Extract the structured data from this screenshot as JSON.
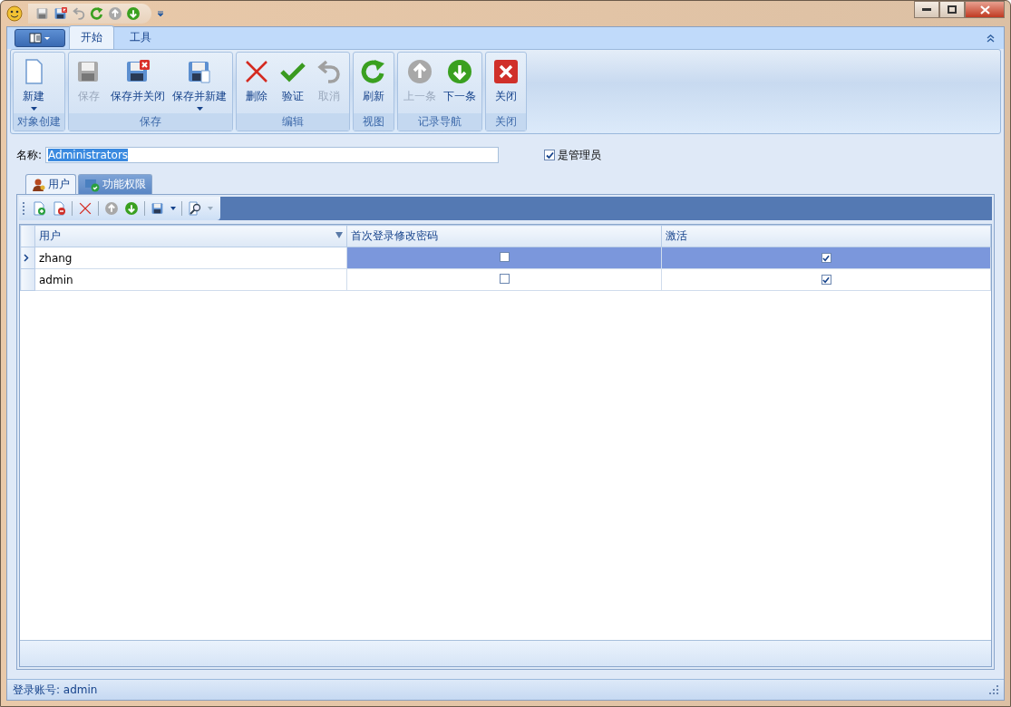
{
  "ribbon": {
    "tabs": [
      {
        "label": "开始",
        "selected": true
      },
      {
        "label": "工具",
        "selected": false
      }
    ],
    "groups": [
      {
        "label": "对象创建",
        "buttons": [
          {
            "kind": "new",
            "label": "新建",
            "disabled": false,
            "dropdown": true
          }
        ]
      },
      {
        "label": "保存",
        "buttons": [
          {
            "kind": "save",
            "label": "保存",
            "disabled": true,
            "dropdown": false
          },
          {
            "kind": "save-close",
            "label": "保存并关闭",
            "disabled": false,
            "dropdown": false
          },
          {
            "kind": "save-new",
            "label": "保存并新建",
            "disabled": false,
            "dropdown": true
          }
        ]
      },
      {
        "label": "编辑",
        "buttons": [
          {
            "kind": "delete",
            "label": "删除",
            "disabled": false,
            "dropdown": false
          },
          {
            "kind": "validate",
            "label": "验证",
            "disabled": false,
            "dropdown": false
          },
          {
            "kind": "cancel",
            "label": "取消",
            "disabled": true,
            "dropdown": false
          }
        ]
      },
      {
        "label": "视图",
        "buttons": [
          {
            "kind": "refresh",
            "label": "刷新",
            "disabled": false,
            "dropdown": false
          }
        ]
      },
      {
        "label": "记录导航",
        "buttons": [
          {
            "kind": "prev",
            "label": "上一条",
            "disabled": true,
            "dropdown": false
          },
          {
            "kind": "next",
            "label": "下一条",
            "disabled": false,
            "dropdown": false
          }
        ]
      },
      {
        "label": "关闭",
        "buttons": [
          {
            "kind": "close",
            "label": "关闭",
            "disabled": false,
            "dropdown": false
          }
        ]
      }
    ]
  },
  "form": {
    "name_label": "名称:",
    "name_value": "Administrators",
    "is_admin": {
      "label": "是管理员",
      "checked": true
    }
  },
  "detail_tabs": [
    {
      "label": "用户",
      "selected": true
    },
    {
      "label": "功能权限",
      "selected": false
    }
  ],
  "grid": {
    "columns": [
      "用户",
      "首次登录修改密码",
      "激活"
    ],
    "rows": [
      {
        "selected": true,
        "user": "zhang",
        "change_password": false,
        "active": true
      },
      {
        "selected": false,
        "user": "admin",
        "change_password": false,
        "active": true
      }
    ]
  },
  "status_bar": "登录账号: admin"
}
